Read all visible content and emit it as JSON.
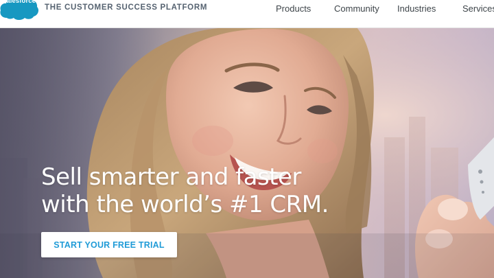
{
  "header": {
    "logo_text": "salesforce",
    "tagline": "THE CUSTOMER SUCCESS PLATFORM",
    "nav": {
      "products": "Products",
      "community": "Community",
      "industries": "Industries",
      "services": "Services"
    }
  },
  "hero": {
    "headline_line1": "Sell smarter and faster",
    "headline_line2": "with the world’s #1 CRM.",
    "cta_label": "START YOUR FREE TRIAL"
  },
  "colors": {
    "brand_blue": "#1f9bd7",
    "logo_cloud": "#1798c1",
    "nav_text": "#3d4449",
    "tagline_text": "#556270"
  },
  "icons": {
    "logo": "salesforce-cloud-logo"
  }
}
